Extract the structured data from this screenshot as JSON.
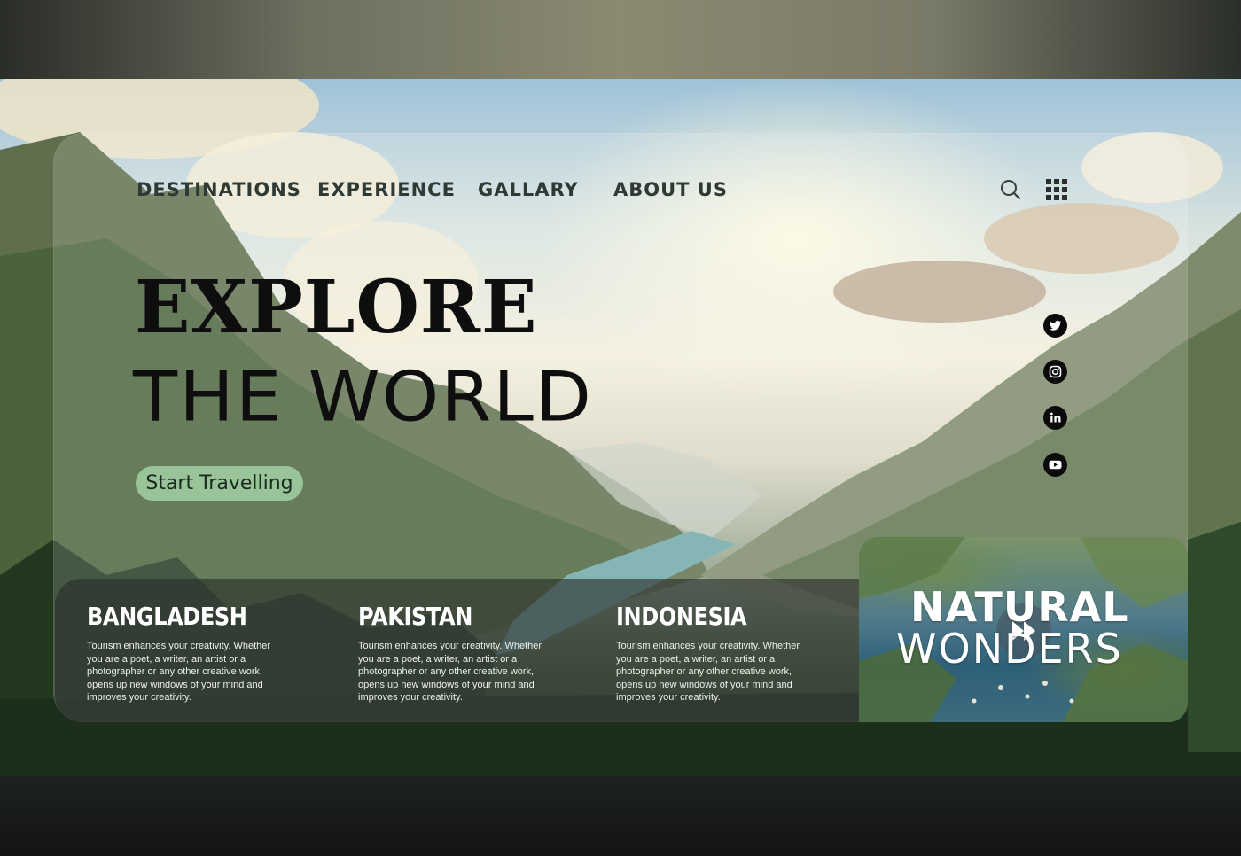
{
  "nav": {
    "items": [
      {
        "label": "DESTINATIONS"
      },
      {
        "label": "EXPERIENCE"
      },
      {
        "label": "GALLARY"
      },
      {
        "label": "ABOUT US"
      }
    ],
    "icons": [
      "search-icon",
      "grid-menu-icon"
    ]
  },
  "hero": {
    "title_line1": "EXPLORE",
    "title_line2": "THE WORLD",
    "cta_label": "Start Travelling"
  },
  "social": [
    "twitter-icon",
    "instagram-icon",
    "linkedin-icon",
    "youtube-icon"
  ],
  "destinations": [
    {
      "name": "BANGLADESH",
      "description": "Tourism enhances your creativity. Whether you are a poet, a writer, an artist or a photographer or any other creative work, opens up new windows of your mind and improves your creativity."
    },
    {
      "name": "PAKISTAN",
      "description": "Tourism enhances your creativity. Whether you are a poet, a writer, an artist or a photographer or any other creative work, opens up new windows of your mind and improves your creativity."
    },
    {
      "name": "INDONESIA",
      "description": "Tourism enhances your creativity. Whether you are a poet, a writer, an artist or a photographer or any other creative work, opens up new windows of your mind and improves your creativity."
    }
  ],
  "video": {
    "title_line1": "NATURAL",
    "title_line2": "WONDERS",
    "icon": "play-icon"
  },
  "colors": {
    "nav_text": "#2f3a35",
    "cta_background": "#a0cda0",
    "headline": "#0e0e0e",
    "strip_background": "#282d2a"
  }
}
